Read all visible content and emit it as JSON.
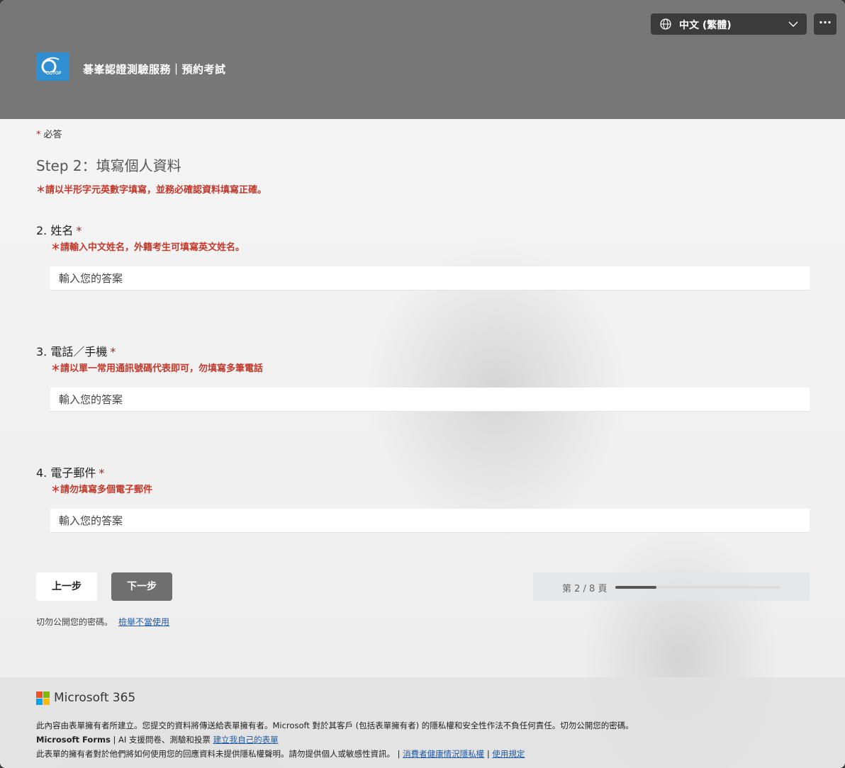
{
  "header": {
    "language": "中文 (繁體)",
    "more_label": "···",
    "title": "碁峯認證測驗服務｜預約考試",
    "logo_text": "GOTOP"
  },
  "form": {
    "required_marker": "*",
    "required_label": "必答",
    "section_title": "Step 2：填寫個人資料",
    "section_note": "＊請以半形字元英數字填寫，並務必確認資料填寫正確。",
    "questions": [
      {
        "label": "2. 姓名",
        "required": "*",
        "hint": "＊請輸入中文姓名，外籍考生可填寫英文姓名。",
        "placeholder": "輸入您的答案"
      },
      {
        "label": "3. 電話／手機",
        "required": "*",
        "hint": "＊請以單一常用通訊號碼代表即可，勿填寫多筆電話",
        "placeholder": "輸入您的答案"
      },
      {
        "label": "4. 電子郵件",
        "required": "*",
        "hint": "＊請勿填寫多個電子郵件",
        "placeholder": "輸入您的答案"
      }
    ],
    "prev_label": "上一步",
    "next_label": "下一步",
    "progress_text": "第 2 / 8 頁",
    "progress_fraction": 0.25,
    "password_note": "切勿公開您的密碼。",
    "report_link": "檢舉不當使用"
  },
  "footer": {
    "brand": "Microsoft 365",
    "line1": "此內容由表單擁有者所建立。您提交的資料將傳送給表單擁有者。Microsoft 對於其客戶 (包括表單擁有者) 的隱私權和安全性作法不負任何責任。切勿公開您的密碼。",
    "line2_bold": "Microsoft Forms",
    "line2_text": " | AI 支援問卷、測驗和投票 ",
    "line2_link": "建立我自己的表單",
    "line3_text": "此表單的擁有者對於他們將如何使用您的回應資料未提供隱私權聲明。請勿提供個人或敏感性資訊。 | ",
    "line3_link1": "消費者健康情況隱私權",
    "line3_sep": " | ",
    "line3_link2": "使用規定"
  },
  "colors": {
    "header_bg": "#777777",
    "required_red": "#a4262c",
    "hint_red": "#c0392b",
    "next_button": "#6f6f6f",
    "link_blue": "#1f5aa6"
  },
  "icons": [
    "globe-icon",
    "chevron-down-icon",
    "more-icon",
    "gotop-logo",
    "microsoft-logo"
  ]
}
